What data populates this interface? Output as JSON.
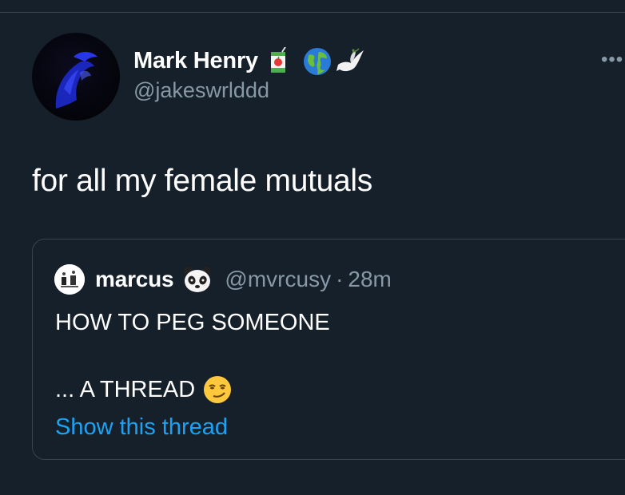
{
  "tweet": {
    "author_name": "Mark Henry",
    "author_handle": "@jakeswrlddd",
    "name_emojis": [
      "juice-box-icon",
      "globe-icon",
      "dove-icon"
    ],
    "text": "for all my female mutuals",
    "more_menu": "•••"
  },
  "quoted_tweet": {
    "author_name": "marcus",
    "name_emoji": "panda-icon",
    "author_handle": "@mvrcusy",
    "separator": "·",
    "time": "28m",
    "line1": "HOW TO PEG SOMEONE",
    "line2": "... A THREAD",
    "line2_emoji": "smirk-icon",
    "show_thread_label": "Show this thread"
  },
  "colors": {
    "background": "#15202b",
    "border": "#38444d",
    "secondary_text": "#8899a6",
    "link": "#1da1f2"
  }
}
